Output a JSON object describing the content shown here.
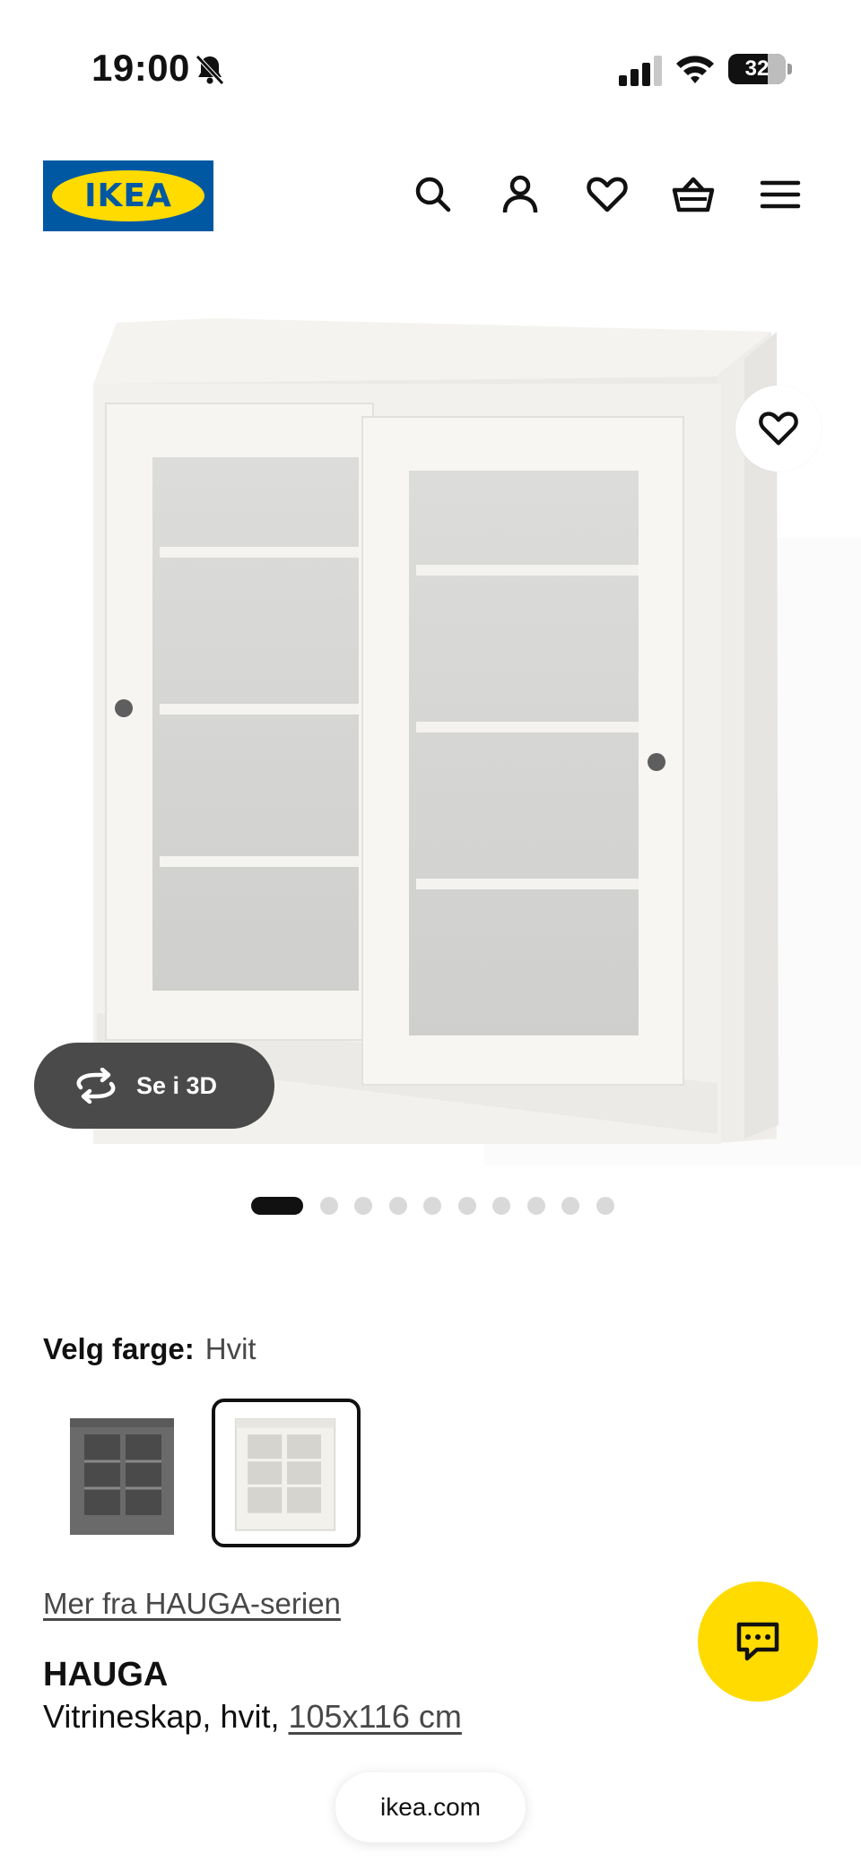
{
  "status_bar": {
    "time": "19:00",
    "battery_percent": "32",
    "battery_level": 0.32,
    "icons": [
      "bell-slash-icon",
      "signal-icon",
      "wifi-icon",
      "battery-icon"
    ]
  },
  "header": {
    "logo_text": "IKEA",
    "brand_colors": {
      "blue": "#0058a3",
      "yellow": "#ffdb00"
    },
    "icons": [
      "search-icon",
      "account-icon",
      "heart-icon",
      "cart-icon",
      "menu-icon"
    ]
  },
  "media": {
    "view_3d_label": "Se i 3D",
    "slides_total": 10,
    "slide_current": 1
  },
  "color": {
    "label": "Velg farge:",
    "value": "Hvit",
    "options": [
      {
        "color": "#6a6a6a",
        "selected": false
      },
      {
        "color": "#f3f1ec",
        "selected": true
      }
    ]
  },
  "series_link": "Mer fra HAUGA-serien",
  "product": {
    "name": "HAUGA",
    "description": "Vitrineskap, hvit, ",
    "size": "105x116 cm"
  },
  "browser": {
    "url": "ikea.com"
  }
}
